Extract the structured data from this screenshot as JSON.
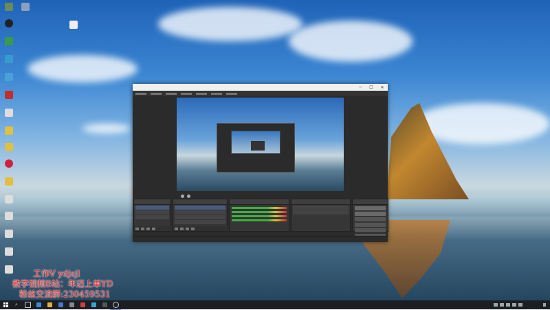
{
  "watermark": {
    "line1": "工作V ydjsjl",
    "line2": "教学视频B站：年迈上单YD",
    "line3": "粉丝交流群:230459531"
  },
  "obs_window": {
    "minimize_glyph": "─",
    "maximize_glyph": "☐",
    "close_glyph": "✕"
  },
  "taskbar": {
    "search_glyph": "⌕"
  },
  "colors": {
    "watermark": "#e8282c",
    "taskbar": "#1b1f24",
    "obs_background": "#2b2b2b"
  }
}
